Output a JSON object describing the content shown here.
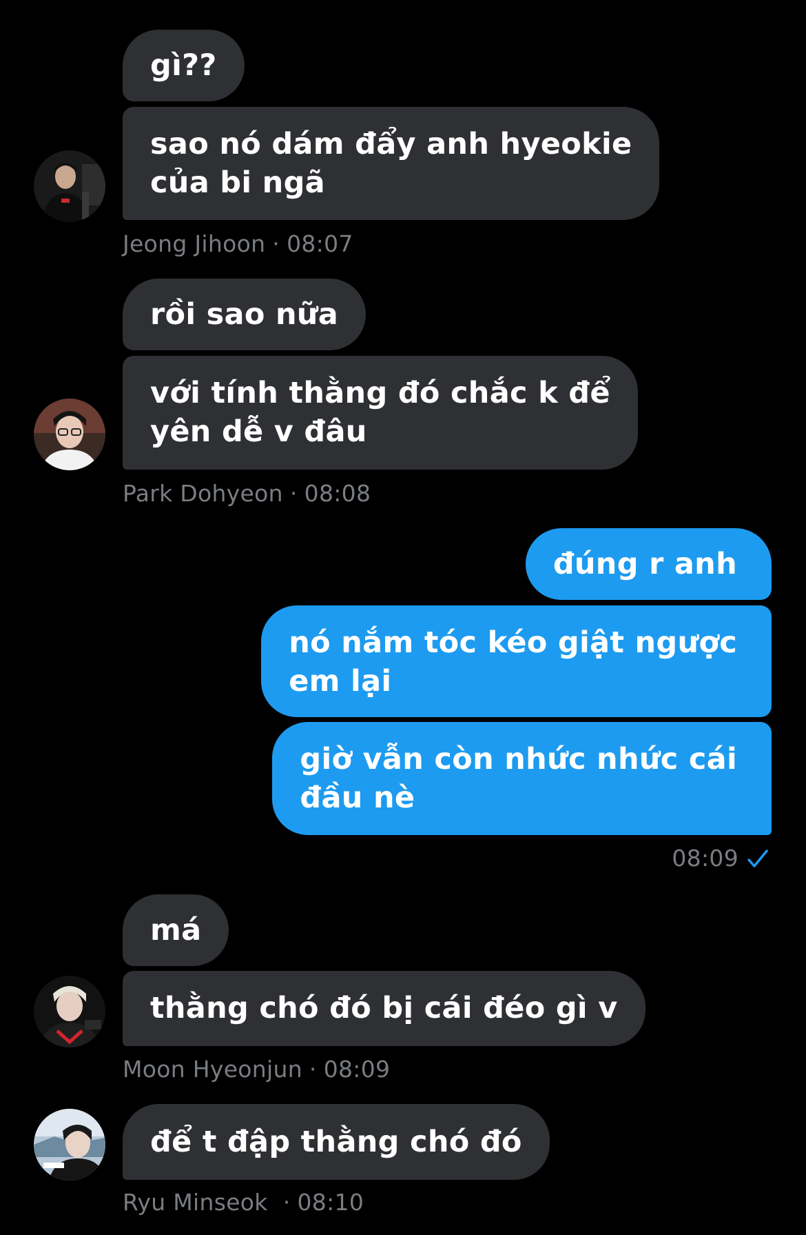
{
  "groups": [
    {
      "sender": "Jeong Jihoon",
      "time": "08:07",
      "messages": [
        {
          "lines": [
            "gì??"
          ]
        },
        {
          "lines": [
            "sao nó dám đẩy anh hyeokie",
            "của bi ngã"
          ]
        }
      ],
      "avatar_icon": "person-photo-icon"
    },
    {
      "sender": "Park Dohyeon",
      "time": "08:08",
      "messages": [
        {
          "lines": [
            "rồi sao nữa"
          ]
        },
        {
          "lines": [
            "với tính thằng đó chắc k để",
            "yên dễ v đâu"
          ]
        }
      ],
      "avatar_icon": "person-photo-icon"
    },
    {
      "sender": "me",
      "time": "08:09",
      "messages": [
        {
          "lines": [
            "đúng r anh"
          ]
        },
        {
          "lines": [
            "nó nắm tóc kéo giật ngược",
            "em lại"
          ]
        },
        {
          "lines": [
            "giờ vẫn còn nhức nhức cái",
            "đầu nè"
          ]
        }
      ],
      "status_icon": "read-check-icon"
    },
    {
      "sender": "Moon Hyeonjun",
      "time": "08:09",
      "messages": [
        {
          "lines": [
            "má"
          ]
        },
        {
          "lines": [
            "thằng chó đó bị cái đéo gì v"
          ]
        }
      ],
      "avatar_icon": "person-photo-icon"
    },
    {
      "sender": "Ryu Minseok",
      "time": "08:10",
      "messages": [
        {
          "lines": [
            "để t đập thằng chó đó"
          ]
        }
      ],
      "avatar_icon": "person-photo-icon"
    }
  ],
  "meta_separator": "·",
  "colors": {
    "background": "#000000",
    "incoming_bubble": "#2f3033",
    "outgoing_bubble": "#1d9bf0",
    "meta_text": "#7a7d82",
    "check": "#1d9bf0"
  }
}
